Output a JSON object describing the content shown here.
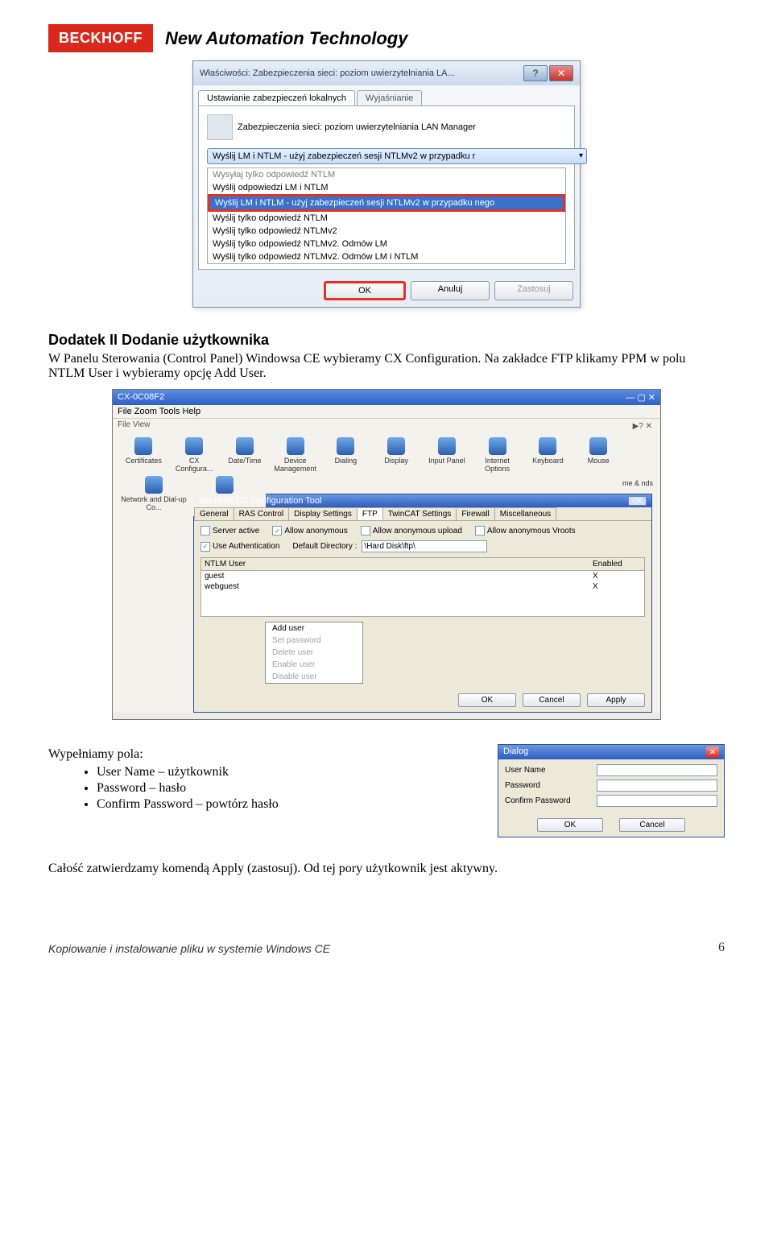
{
  "header": {
    "logo": "BECKHOFF",
    "title": "New Automation Technology"
  },
  "dialog1": {
    "title": "Właściwości: Zabezpieczenia sieci: poziom uwierzytelniania LA...",
    "tabs": {
      "t1": "Ustawianie zabezpieczeń lokalnych",
      "t2": "Wyjaśnianie"
    },
    "policy": "Zabezpieczenia sieci: poziom uwierzytelniania LAN Manager",
    "dropdown": "Wyślij LM i NTLM - użyj zabezpieczeń sesji NTLMv2 w przypadku r",
    "items": {
      "i0": "Wysyłaj tylko odpowiedź NTLM",
      "i1": "Wyślij odpowiedzi LM i NTLM",
      "i2": "Wyślij LM i NTLM - użyj zabezpieczeń sesji NTLMv2 w przypadku nego",
      "i3": "Wyślij tylko odpowiedź NTLM",
      "i4": "Wyślij tylko odpowiedź NTLMv2",
      "i5": "Wyślij tylko odpowiedź NTLMv2. Odmów LM",
      "i6": "Wyślij tylko odpowiedź NTLMv2. Odmów LM i NTLM"
    },
    "buttons": {
      "ok": "OK",
      "cancel": "Anuluj",
      "apply": "Zastosuj"
    },
    "tbHelp": "?",
    "tbClose": "✕"
  },
  "text": {
    "heading": "Dodatek II Dodanie użytkownika",
    "para": "W Panelu Sterowania (Control Panel) Windowsa CE wybieramy CX Configuration. Na zakładce FTP klikamy PPM w polu NTLM User i wybieramy opcję Add User.",
    "fill": "Wypełniamy pola:",
    "b1": "User Name – użytkownik",
    "b2": "Password – hasło",
    "b3": "Confirm Password – powtórz hasło",
    "last": "Całość zatwierdzamy komendą Apply (zastosuj). Od tej pory użytkownik jest aktywny."
  },
  "cfg": {
    "deviceTitle": "CX-0C08F2",
    "menu": "File   Zoom   Tools   Help",
    "toolbar": "File   View",
    "help": "▶? ✕",
    "icons": {
      "i0": "Certificates",
      "i1": "CX Configura...",
      "i2": "Date/Time",
      "i3": "Device Management",
      "i4": "Dialing",
      "i5": "Display",
      "i6": "Input Panel",
      "i7": "Internet Options",
      "i8": "Keyboard",
      "i9": "Mouse",
      "i10": "Network and Dial-up Co...",
      "side": "me & nds"
    },
    "title": "Beckhoff CX Configuration Tool",
    "ok": "OK",
    "tabs": {
      "t0": "General",
      "t1": "RAS Control",
      "t2": "Display Settings",
      "t3": "FTP",
      "t4": "TwinCAT Settings",
      "t5": "Firewall",
      "t6": "Miscellaneous"
    },
    "chk": {
      "server": "Server active",
      "anon": "Allow anonymous",
      "upload": "Allow anonymous upload",
      "vroots": "Allow anonymous Vroots",
      "auth": "Use Authentication",
      "defdirLabel": "Default Directory :",
      "defdir": "\\Hard Disk\\ftp\\"
    },
    "ntlm": {
      "h1": "NTLM User",
      "h2": "Enabled",
      "r1u": "guest",
      "r1e": "X",
      "r2u": "webguest",
      "r2e": "X"
    },
    "ctx": {
      "m0": "Add user",
      "m1": "Set password",
      "m2": "Delete user",
      "m3": "Enable user",
      "m4": "Disable user"
    },
    "btns": {
      "ok": "OK",
      "cancel": "Cancel",
      "apply": "Apply"
    }
  },
  "dlg3": {
    "title": "Dialog",
    "lUser": "User Name",
    "lPass": "Password",
    "lConf": "Confirm Password",
    "ok": "OK",
    "cancel": "Cancel"
  },
  "footer": {
    "text": "Kopiowanie i instalowanie pliku w systemie Windows CE",
    "page": "6"
  }
}
